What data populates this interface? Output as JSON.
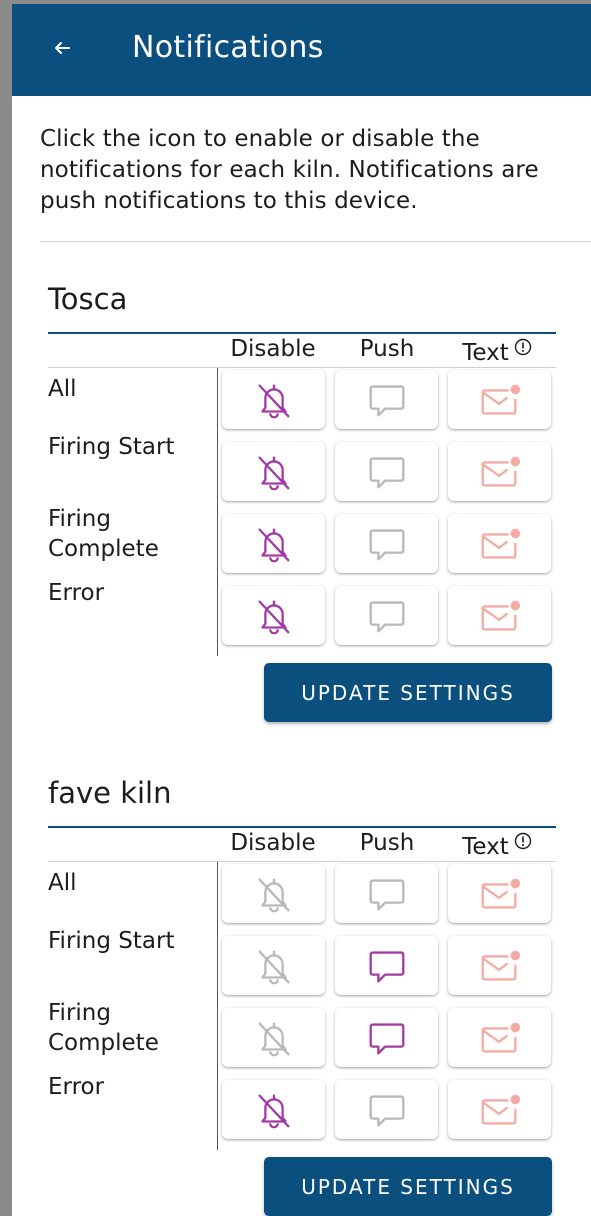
{
  "header": {
    "title": "Notifications",
    "back_icon": "arrow-left-icon"
  },
  "intro": "Click the icon to enable or disable the notifications for each kiln. Notifications are push notifications to this device.",
  "colors": {
    "primary": "#0a4f7e",
    "active_purple": "#a23aa6",
    "inactive_gray": "#b8b8b8",
    "text_pink": "#f3aba3"
  },
  "kilns": [
    {
      "name": "Tosca",
      "columns": {
        "disable": "Disable",
        "push": "Push",
        "text": "Text",
        "text_info_icon": "info-circle-icon"
      },
      "rows": [
        {
          "label": "All",
          "disable_active": true,
          "push_active": false
        },
        {
          "label": "Firing Start",
          "disable_active": true,
          "push_active": false
        },
        {
          "label": "Firing\nComplete",
          "disable_active": true,
          "push_active": false
        },
        {
          "label": "Error",
          "disable_active": true,
          "push_active": false
        }
      ],
      "update_label": "UPDATE SETTINGS"
    },
    {
      "name": "fave kiln",
      "columns": {
        "disable": "Disable",
        "push": "Push",
        "text": "Text",
        "text_info_icon": "info-circle-icon"
      },
      "rows": [
        {
          "label": "All",
          "disable_active": false,
          "push_active": false
        },
        {
          "label": "Firing Start",
          "disable_active": false,
          "push_active": true
        },
        {
          "label": "Firing\nComplete",
          "disable_active": false,
          "push_active": true
        },
        {
          "label": "Error",
          "disable_active": true,
          "push_active": false
        }
      ],
      "update_label": "UPDATE SETTINGS"
    }
  ]
}
